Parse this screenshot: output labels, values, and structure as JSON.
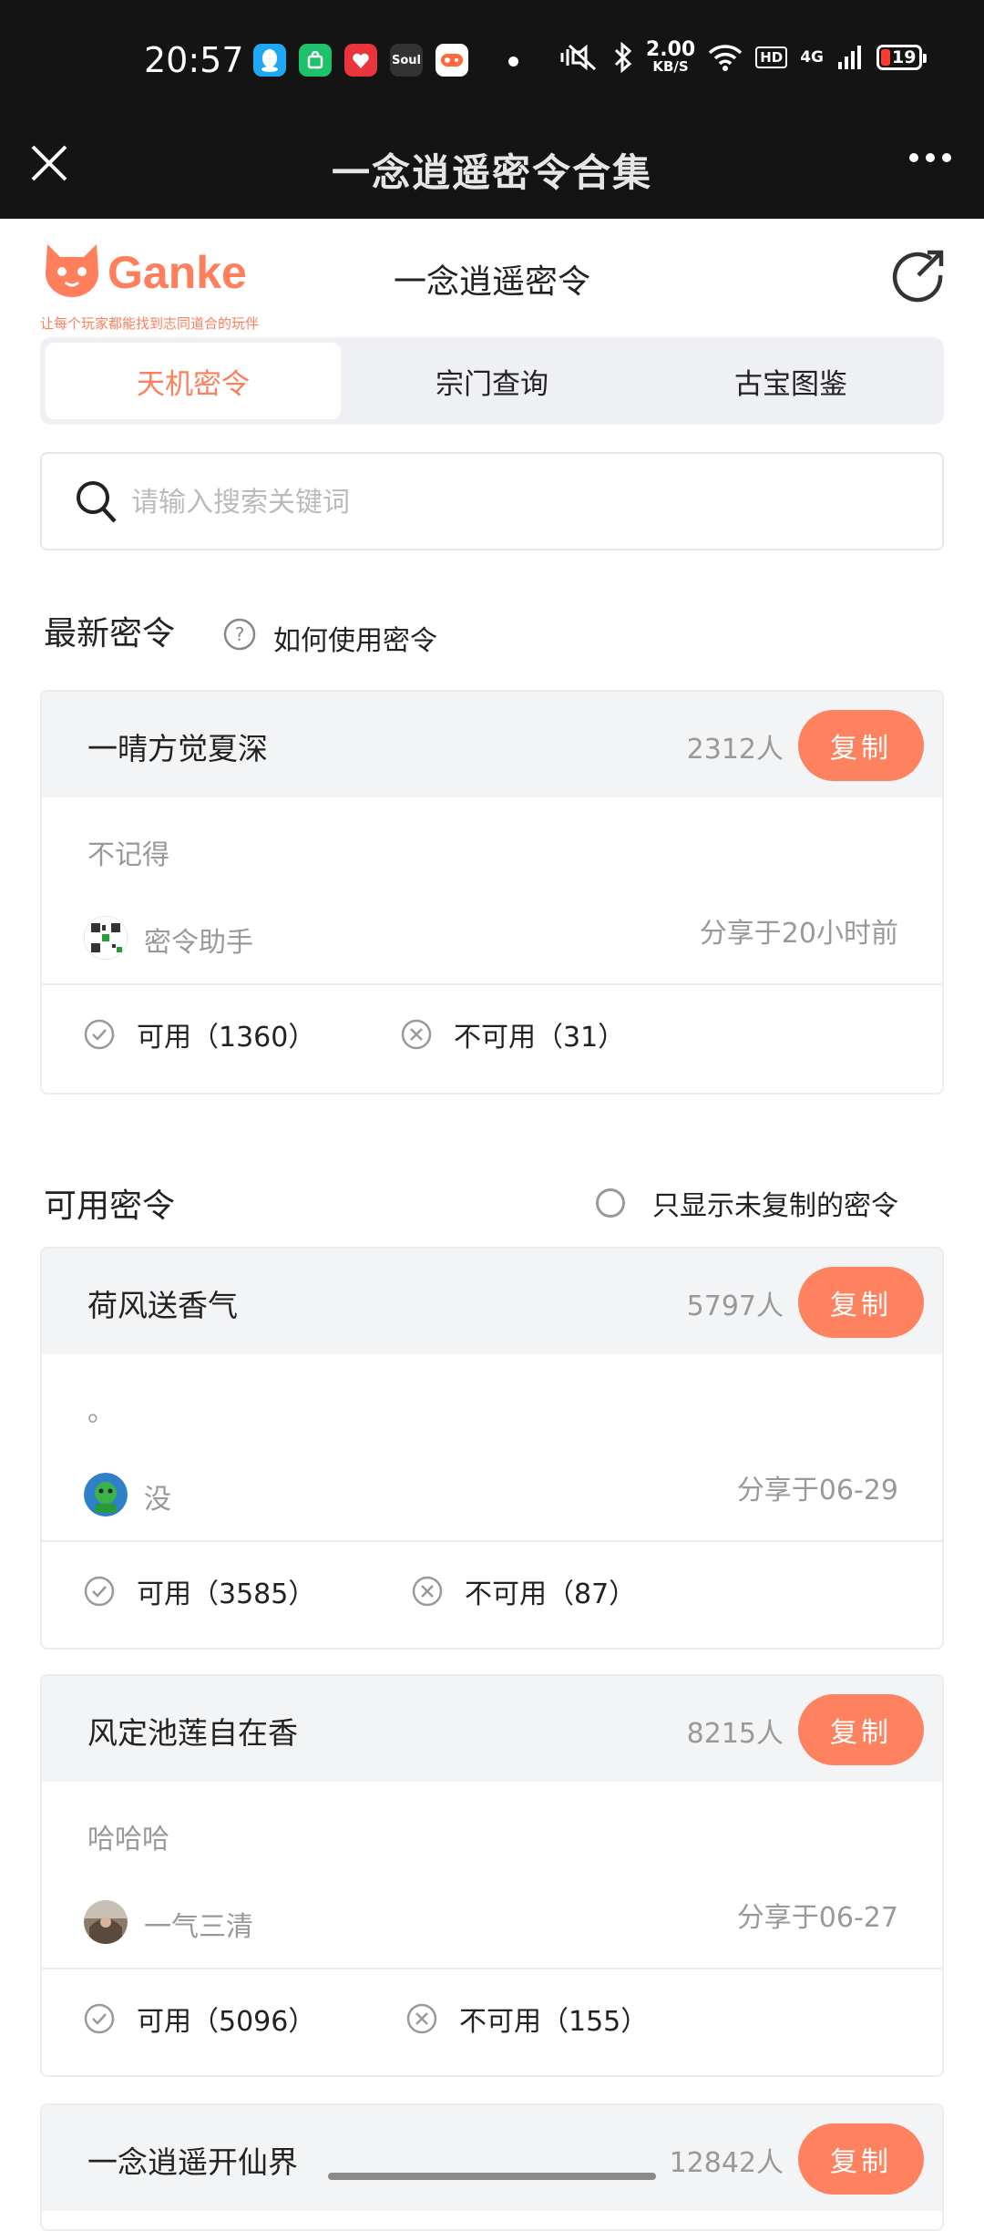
{
  "status_bar": {
    "time": "20:57",
    "app_icons": [
      {
        "icon": "qq-icon",
        "color": "#1ea7f5",
        "label": ""
      },
      {
        "icon": "shop-app-icon",
        "color": "#1ec26a",
        "label": ""
      },
      {
        "icon": "gift-app-icon",
        "color": "#e8343a",
        "label": ""
      },
      {
        "icon": "soul-app-icon",
        "color": "#333333",
        "label": "Soul"
      },
      {
        "icon": "game-app-icon",
        "color": "#ffffff",
        "label": ""
      }
    ],
    "net_speed_value": "2.00",
    "net_speed_unit": "KB/S",
    "hd_label": "HD",
    "signal_type": "4G",
    "battery": "19"
  },
  "title_bar": {
    "title": "一念逍遥密令合集"
  },
  "header": {
    "logo_text": "Ganke",
    "logo_slogan": "让每个玩家都能找到志同道合的玩伴",
    "title": "一念逍遥密令"
  },
  "tabs": [
    {
      "label": "天机密令",
      "active": true
    },
    {
      "label": "宗门查询",
      "active": false
    },
    {
      "label": "古宝图鉴",
      "active": false
    }
  ],
  "search": {
    "placeholder": "请输入搜索关键词"
  },
  "latest": {
    "title": "最新密令",
    "help_text": "如何使用密令"
  },
  "available": {
    "title": "可用密令",
    "filter_label": "只显示未复制的密令"
  },
  "colors": {
    "accent": "#ff8260",
    "brand": "#ff7e5b",
    "title_bar_bg": "#141414"
  },
  "cards": [
    {
      "name": "一晴方觉夏深",
      "count": "2312人",
      "copy_label": "复制",
      "desc": "不记得",
      "author": "密令助手",
      "time": "分享于20小时前",
      "avatar": "qr-code-avatar",
      "yes": "可用（1360）",
      "no": "不可用（31）"
    },
    {
      "name": "荷风送香气",
      "count": "5797人",
      "copy_label": "复制",
      "desc": "。",
      "author": "没",
      "time": "分享于06-29",
      "avatar": "green-character-avatar",
      "yes": "可用（3585）",
      "no": "不可用（87）"
    },
    {
      "name": "风定池莲自在香",
      "count": "8215人",
      "copy_label": "复制",
      "desc": "哈哈哈",
      "author": "一气三清",
      "time": "分享于06-27",
      "avatar": "photo-avatar",
      "yes": "可用（5096）",
      "no": "不可用（155）"
    },
    {
      "name": "一念逍遥开仙界",
      "count": "12842人",
      "copy_label": "复制"
    }
  ]
}
